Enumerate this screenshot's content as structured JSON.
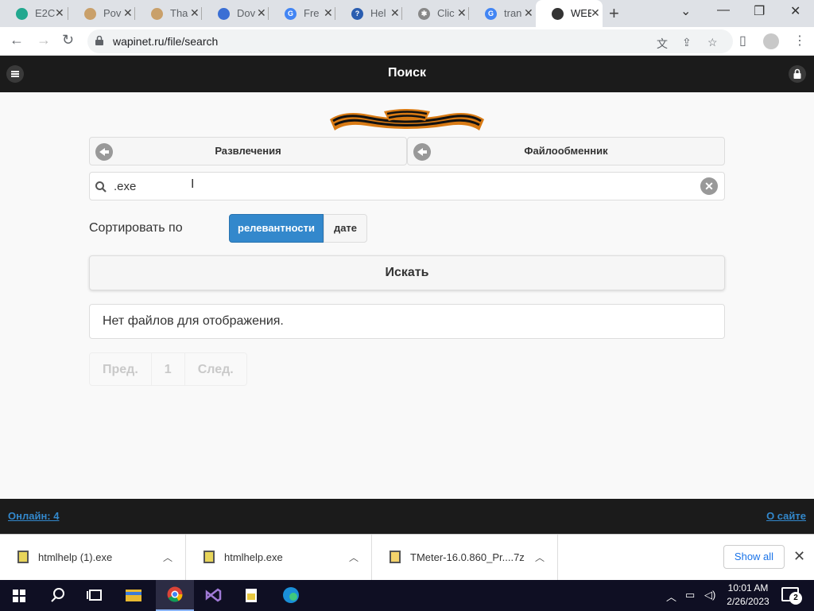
{
  "browser": {
    "tabs": [
      {
        "title": "E2C",
        "favicon": "e2c-icon",
        "color": "#22a88f"
      },
      {
        "title": "Pov",
        "favicon": "globe-icon",
        "color": "#c9a06a"
      },
      {
        "title": "Tha",
        "favicon": "globe-icon",
        "color": "#c9a06a"
      },
      {
        "title": "Dov",
        "favicon": "dov-icon",
        "color": "#3b6fd4"
      },
      {
        "title": "Fre",
        "favicon": "google-icon",
        "color": "#4285f4"
      },
      {
        "title": "Hel",
        "favicon": "help-icon",
        "color": "#2a5db0"
      },
      {
        "title": "Clic",
        "favicon": "spinner-icon",
        "color": "#888888"
      },
      {
        "title": "tran",
        "favicon": "google-icon",
        "color": "#4285f4"
      },
      {
        "title": "WEB",
        "favicon": "ribbon-icon",
        "color": "#333333"
      }
    ],
    "url": "wapinet.ru/file/search"
  },
  "header": {
    "title": "Поиск"
  },
  "nav": {
    "prev_label": "Развлечения",
    "next_label": "Файлообменник"
  },
  "search": {
    "value": ".exe"
  },
  "sort": {
    "label": "Сортировать по",
    "options": [
      "релевантности",
      "дате"
    ],
    "selected": "релевантности"
  },
  "search_button": "Искать",
  "results": {
    "empty_message": "Нет файлов для отображения."
  },
  "pager": {
    "prev": "Пред.",
    "page": "1",
    "next": "След."
  },
  "footer": {
    "online": "Онлайн: 4",
    "about": "О сайте"
  },
  "downloads": {
    "items": [
      {
        "name": "htmlhelp (1).exe"
      },
      {
        "name": "htmlhelp.exe"
      },
      {
        "name": "TMeter-16.0.860_Pr....7z"
      }
    ],
    "show_all": "Show all"
  },
  "taskbar": {
    "time": "10:01 AM",
    "date": "2/26/2023",
    "notifications": "2"
  },
  "colors": {
    "accent": "#3388cc",
    "header_bg": "#1b1b1b",
    "link": "#3388cc"
  }
}
